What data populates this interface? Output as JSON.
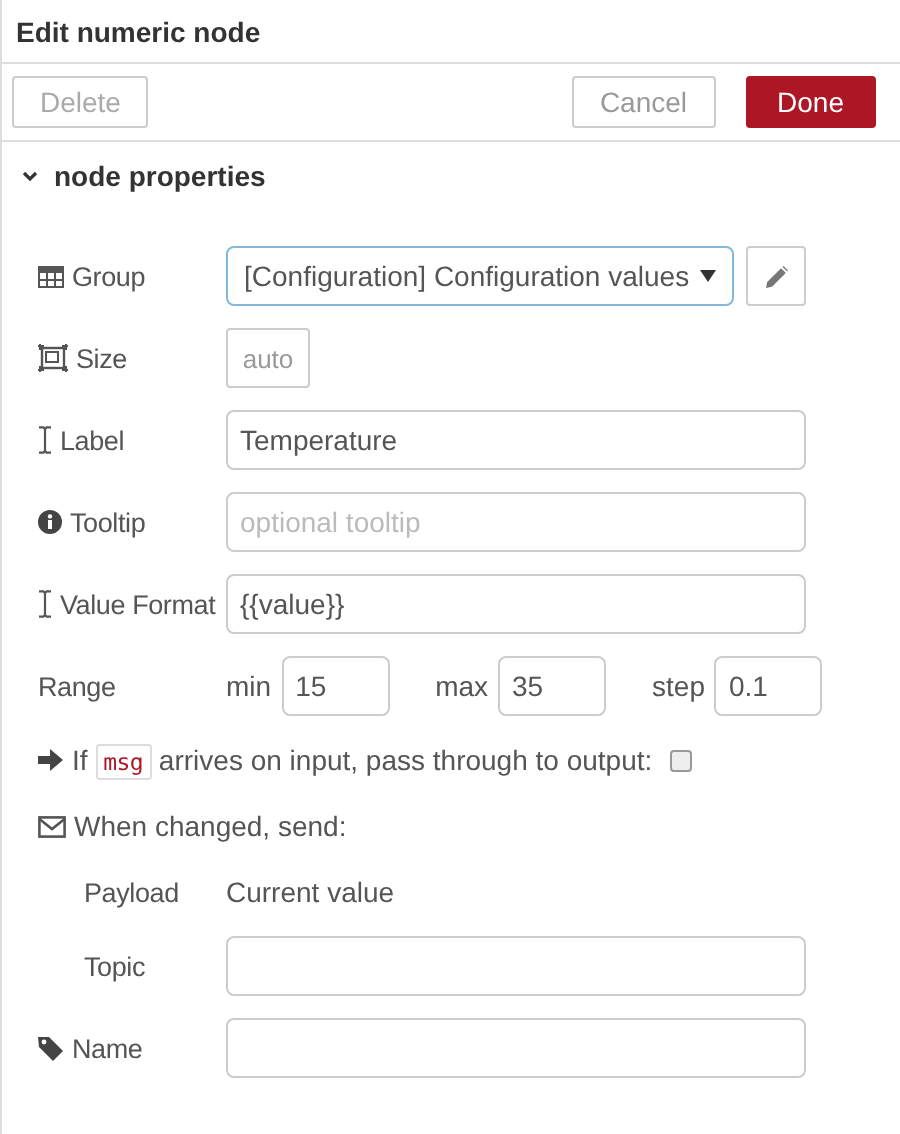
{
  "tray": {
    "title": "Edit numeric node",
    "buttons": [
      {
        "label": "Delete",
        "kind": "secondary",
        "disabled": true
      },
      {
        "label": "Cancel",
        "kind": "secondary",
        "disabled": false
      },
      {
        "label": "Done",
        "kind": "primary",
        "disabled": false
      }
    ]
  },
  "section": {
    "title": "node properties",
    "expanded": true
  },
  "rows": [
    {
      "kind": "select",
      "label": "Group",
      "value": "[Configuration] Configuration values",
      "focused": true
    },
    {
      "kind": "size",
      "label": "Size",
      "value": "auto"
    },
    {
      "kind": "text",
      "label": "Label",
      "value": "Temperature"
    },
    {
      "kind": "text",
      "label": "Tooltip",
      "placeholder": "optional tooltip"
    },
    {
      "kind": "text",
      "label": "Value Format",
      "value": "{{value}}"
    },
    {
      "kind": "range",
      "label": "Range",
      "parts": [
        {
          "label": "min",
          "value": "15"
        },
        {
          "label": "max",
          "value": "35"
        },
        {
          "label": "step",
          "value": "0.1"
        }
      ]
    },
    {
      "kind": "checkbox",
      "before": "If",
      "code": "msg",
      "after": "arrives on input, pass through to output:",
      "checked": false
    },
    {
      "kind": "heading",
      "label": "When changed, send:",
      "children": [
        {
          "kind": "static",
          "label": "Payload",
          "value": "Current value"
        },
        {
          "kind": "text",
          "label": "Topic"
        }
      ]
    },
    {
      "kind": "text",
      "label": "Name"
    }
  ]
}
